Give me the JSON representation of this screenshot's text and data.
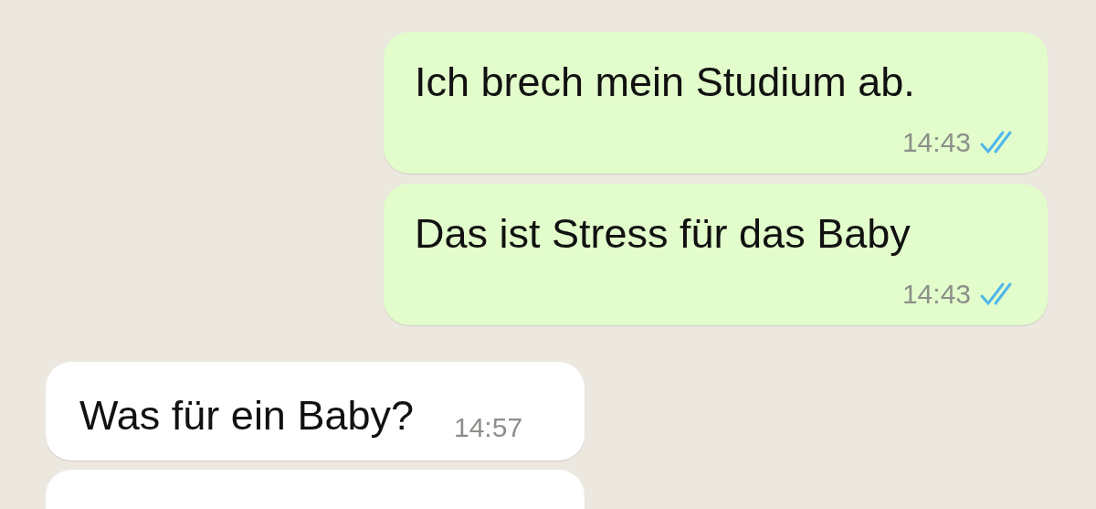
{
  "messages": [
    {
      "kind": "outgoing",
      "text": "Ich brech mein Studium ab.",
      "time": "14:43",
      "read": true
    },
    {
      "kind": "outgoing",
      "text": "Das ist Stress für das Baby",
      "time": "14:43",
      "read": true
    },
    {
      "kind": "incoming",
      "text": "Was für ein Baby?",
      "time": "14:57"
    },
    {
      "kind": "incoming"
    }
  ]
}
